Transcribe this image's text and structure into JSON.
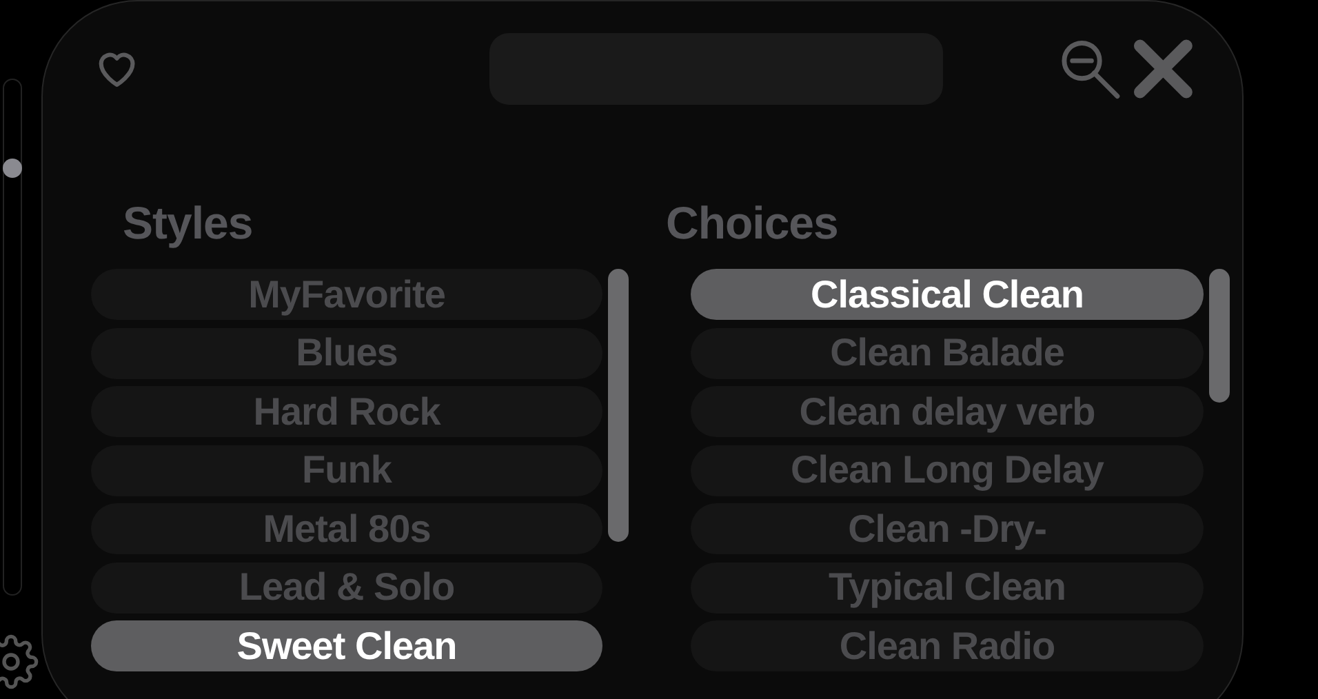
{
  "volume_slider": {
    "level": 0.83
  },
  "styles": {
    "title": "Styles",
    "items": [
      {
        "label": "MyFavorite",
        "selected": false
      },
      {
        "label": "Blues",
        "selected": false
      },
      {
        "label": "Hard Rock",
        "selected": false
      },
      {
        "label": "Funk",
        "selected": false
      },
      {
        "label": "Metal 80s",
        "selected": false
      },
      {
        "label": "Lead & Solo",
        "selected": false
      },
      {
        "label": "Sweet Clean",
        "selected": true
      }
    ]
  },
  "choices": {
    "title": "Choices",
    "items": [
      {
        "label": "Classical Clean",
        "selected": true
      },
      {
        "label": "Clean Balade",
        "selected": false
      },
      {
        "label": "Clean delay verb",
        "selected": false
      },
      {
        "label": "Clean Long Delay",
        "selected": false
      },
      {
        "label": "Clean -Dry-",
        "selected": false
      },
      {
        "label": "Typical Clean",
        "selected": false
      },
      {
        "label": "Clean Radio",
        "selected": false
      }
    ]
  }
}
